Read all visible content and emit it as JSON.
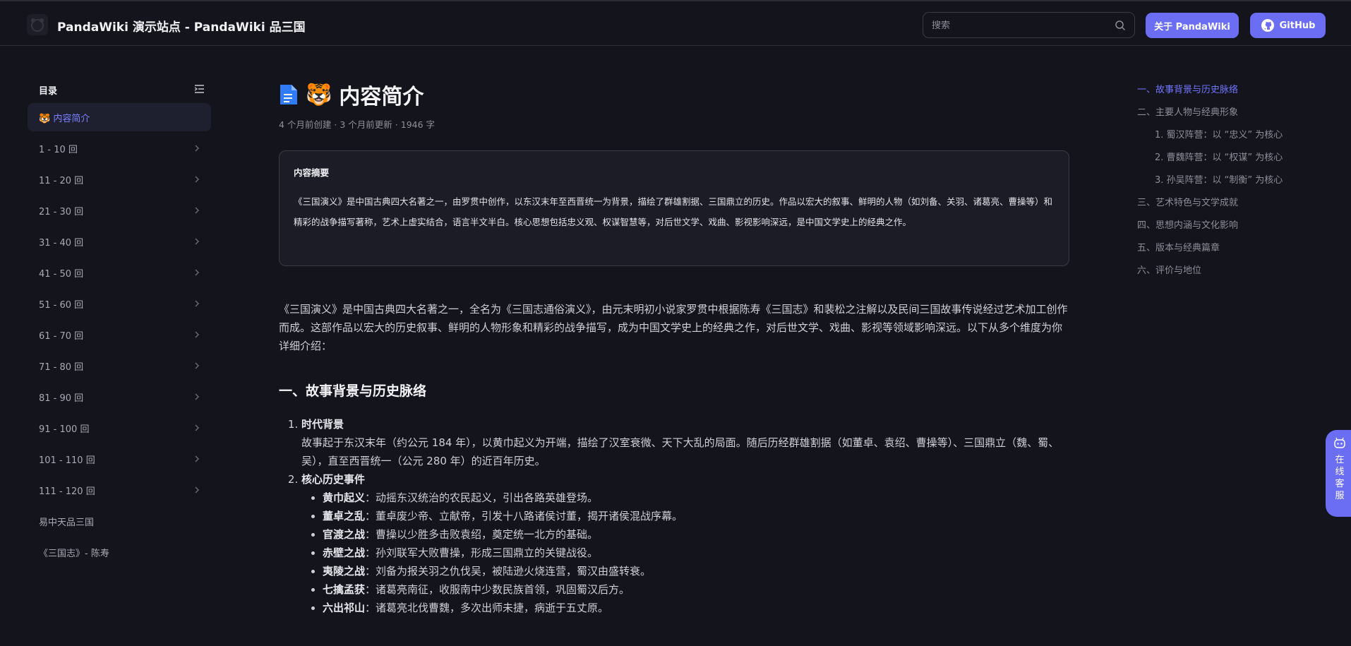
{
  "header": {
    "site_title": "PandaWiki 演示站点 - PandaWiki 品三国",
    "search_placeholder": "搜索",
    "about_label": "关于 PandaWiki",
    "github_label": "GitHub",
    "accent_color": "#6b6ef2"
  },
  "sidebar": {
    "title": "目录",
    "items": [
      {
        "label": "🐯 内容简介",
        "active": true
      },
      {
        "label": "1 - 10 回",
        "chevron": true
      },
      {
        "label": "11 - 20 回",
        "chevron": true
      },
      {
        "label": "21 - 30 回",
        "chevron": true
      },
      {
        "label": "31 - 40 回",
        "chevron": true
      },
      {
        "label": "41 - 50 回",
        "chevron": true
      },
      {
        "label": "51 - 60 回",
        "chevron": true
      },
      {
        "label": "61 - 70 回",
        "chevron": true
      },
      {
        "label": "71 - 80 回",
        "chevron": true
      },
      {
        "label": "81 - 90 回",
        "chevron": true
      },
      {
        "label": "91 - 100 回",
        "chevron": true
      },
      {
        "label": "101 - 110 回",
        "chevron": true
      },
      {
        "label": "111 - 120 回",
        "chevron": true
      },
      {
        "label": "易中天品三国",
        "chevron": false
      },
      {
        "label": "《三国志》- 陈寿",
        "chevron": false
      }
    ]
  },
  "article": {
    "emoji": "🐯",
    "title": "内容简介",
    "created": "4 个月前创建",
    "updated": "3 个月前更新",
    "words": "1946 字",
    "summary_heading": "内容摘要",
    "summary_text": "《三国演义》是中国古典四大名著之一，由罗贯中创作，以东汉末年至西晋统一为背景，描绘了群雄割据、三国鼎立的历史。作品以宏大的叙事、鲜明的人物（如刘备、关羽、诸葛亮、曹操等）和精彩的战争描写著称，艺术上虚实结合，语言半文半白。核心思想包括忠义观、权谋智慧等，对后世文学、戏曲、影视影响深远，是中国文学史上的经典之作。",
    "intro": "《三国演义》是中国古典四大名著之一，全名为《三国志通俗演义》，由元末明初小说家罗贯中根据陈寿《三国志》和裴松之注解以及民间三国故事传说经过艺术加工创作而成。这部作品以宏大的历史叙事、鲜明的人物形象和精彩的战争描写，成为中国文学史上的经典之作，对后世文学、戏曲、影视等领域影响深远。以下从多个维度为你详细介绍：",
    "section1_heading": "一、故事背景与历史脉络",
    "item1_title": "时代背景",
    "item1_text": "故事起于东汉末年（约公元 184 年），以黄巾起义为开端，描绘了汉室衰微、天下大乱的局面。随后历经群雄割据（如董卓、袁绍、曹操等）、三国鼎立（魏、蜀、吴），直至西晋统一（公元 280 年）的近百年历史。",
    "item2_title": "核心历史事件",
    "events": [
      {
        "name": "黄巾起义",
        "desc": "：动摇东汉统治的农民起义，引出各路英雄登场。"
      },
      {
        "name": "董卓之乱",
        "desc": "：董卓废少帝、立献帝，引发十八路诸侯讨董，揭开诸侯混战序幕。"
      },
      {
        "name": "官渡之战",
        "desc": "：曹操以少胜多击败袁绍，奠定统一北方的基础。"
      },
      {
        "name": "赤壁之战",
        "desc": "：孙刘联军大败曹操，形成三国鼎立的关键战役。"
      },
      {
        "name": "夷陵之战",
        "desc": "：刘备为报关羽之仇伐吴，被陆逊火烧连营，蜀汉由盛转衰。"
      },
      {
        "name": "七擒孟获",
        "desc": "：诸葛亮南征，收服南中少数民族首领，巩固蜀汉后方。"
      },
      {
        "name": "六出祁山",
        "desc": "：诸葛亮北伐曹魏，多次出师未捷，病逝于五丈原。"
      }
    ]
  },
  "right_toc": [
    {
      "label": "一、故事背景与历史脉络",
      "level": 1,
      "active": true
    },
    {
      "label": "二、主要人物与经典形象",
      "level": 1
    },
    {
      "label": "1. 蜀汉阵营：以 “忠义” 为核心",
      "level": 2
    },
    {
      "label": "2. 曹魏阵营：以 “权谋” 为核心",
      "level": 2
    },
    {
      "label": "3. 孙吴阵营：以 “制衡” 为核心",
      "level": 2
    },
    {
      "label": "三、艺术特色与文学成就",
      "level": 1
    },
    {
      "label": "四、思想内涵与文化影响",
      "level": 1
    },
    {
      "label": "五、版本与经典篇章",
      "level": 1
    },
    {
      "label": "六、评价与地位",
      "level": 1
    }
  ],
  "service": {
    "label": "在线客服"
  }
}
